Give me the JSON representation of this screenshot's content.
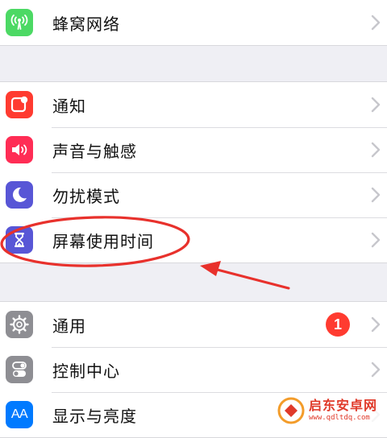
{
  "colors": {
    "background": "#efeff4",
    "cellular": "#4cd964",
    "notifications": "#ff3b30",
    "sounds": "#ff2d55",
    "dnd": "#5856d6",
    "screen_time": "#5856d6",
    "general": "#8e8e93",
    "control_center": "#8e8e93",
    "display": "#007aff",
    "badge": "#ff3b30",
    "annotation": "#e8312c",
    "chevron": "#c7c7cc"
  },
  "groups": [
    {
      "items": [
        {
          "label": "蜂窝网络",
          "icon": "cellular-antenna-icon"
        }
      ]
    },
    {
      "items": [
        {
          "label": "通知",
          "icon": "notifications-icon"
        },
        {
          "label": "声音与触感",
          "icon": "speaker-icon"
        },
        {
          "label": "勿扰模式",
          "icon": "moon-icon"
        },
        {
          "label": "屏幕使用时间",
          "icon": "hourglass-icon"
        }
      ]
    },
    {
      "items": [
        {
          "label": "通用",
          "icon": "gear-icon",
          "badge": "1"
        },
        {
          "label": "控制中心",
          "icon": "toggles-icon"
        },
        {
          "label": "显示与亮度",
          "icon": "display-aa-icon",
          "icon_text": "AA"
        }
      ]
    }
  ],
  "watermark": {
    "title": "启东安卓网",
    "url": "www.qdltdq.com"
  }
}
